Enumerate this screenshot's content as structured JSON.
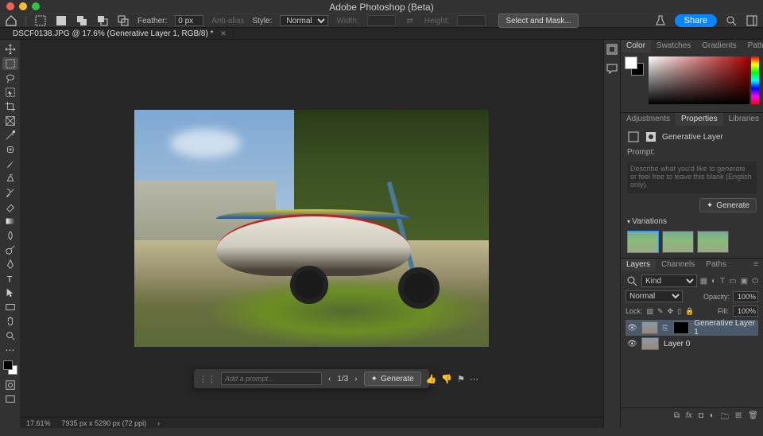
{
  "app_title": "Adobe Photoshop (Beta)",
  "optbar": {
    "feather_label": "Feather:",
    "feather_value": "0 px",
    "antialias": "Anti-alias",
    "style_label": "Style:",
    "style_value": "Normal",
    "width_label": "Width:",
    "height_label": "Height:",
    "select_mask": "Select and Mask...",
    "share": "Share"
  },
  "doc_tab": "DSCF0138.JPG @ 17.6% (Generative Layer 1, RGB/8) *",
  "taskbar": {
    "placeholder": "Add a prompt...",
    "counter": "1/3",
    "generate": "Generate"
  },
  "status": {
    "zoom": "17.61%",
    "dims": "7935 px x 5290 px (72 ppi)"
  },
  "color_tabs": [
    "Color",
    "Swatches",
    "Gradients",
    "Patterns"
  ],
  "adjust_tabs": [
    "Adjustments",
    "Properties",
    "Libraries"
  ],
  "props": {
    "kind": "Generative Layer",
    "prompt_label": "Prompt:",
    "prompt_placeholder": "Describe what you'd like to generate or feel free to leave this blank (English only).",
    "generate": "Generate",
    "variations": "Variations"
  },
  "layers_tabs": [
    "Layers",
    "Channels",
    "Paths"
  ],
  "layers": {
    "kind": "Kind",
    "blend": "Normal",
    "opacity_label": "Opacity:",
    "opacity": "100%",
    "lock_label": "Lock:",
    "fill_label": "Fill:",
    "fill": "100%",
    "items": [
      {
        "name": "Generative Layer 1"
      },
      {
        "name": "Layer 0"
      }
    ]
  }
}
